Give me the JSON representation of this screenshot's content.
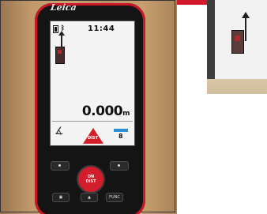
{
  "device": {
    "brand": "Leica",
    "status_bar": {
      "bluetooth": "ᛒ",
      "time": "11:44"
    },
    "reading": {
      "value": "0.000",
      "unit": "m"
    },
    "softkeys": {
      "left_icon": "measure-angle-icon",
      "center_label": "DIST",
      "right_number": "8"
    },
    "buttons": {
      "on_label_top": "ON",
      "on_label_bottom": "DIST",
      "func_label": "FUNC"
    }
  }
}
